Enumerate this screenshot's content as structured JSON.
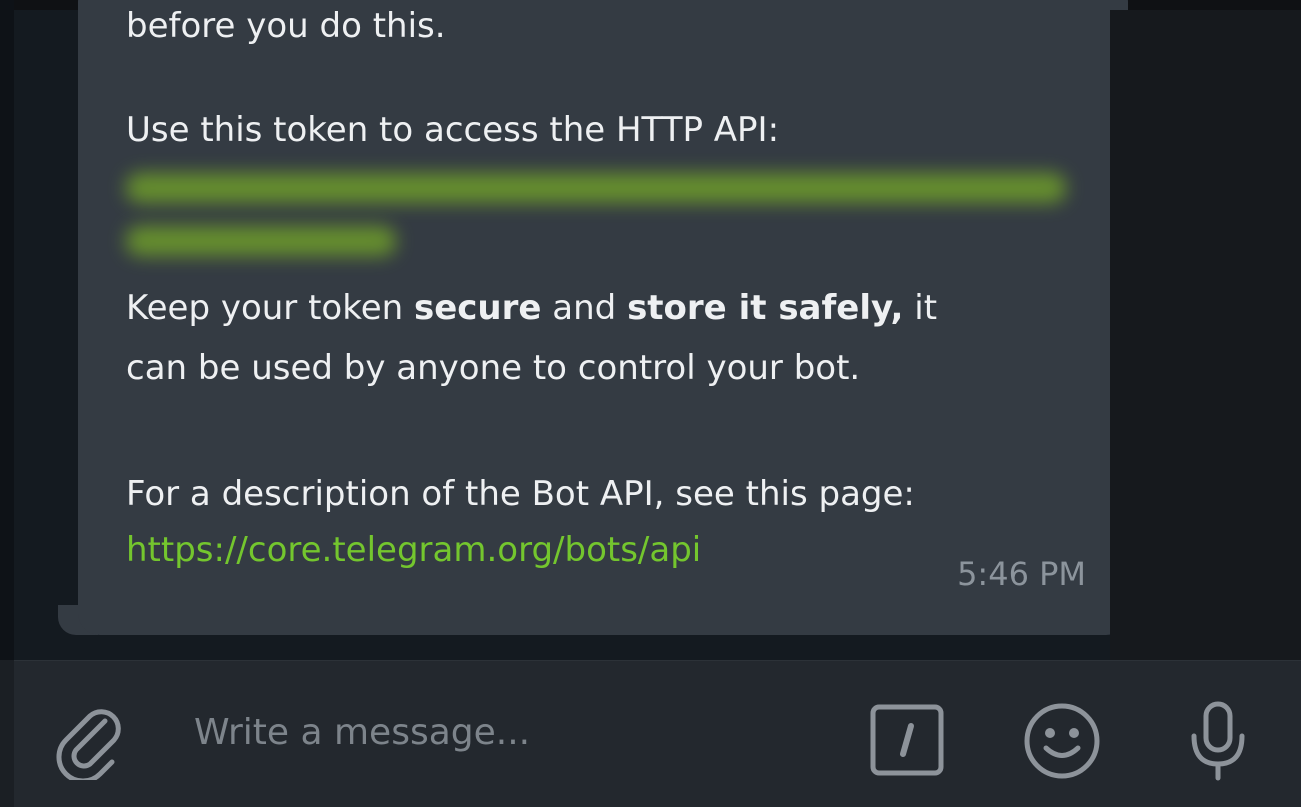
{
  "message": {
    "line_before": "before you do this.",
    "token_intro": "Use this token to access the HTTP API:",
    "keep_prefix": "Keep your token ",
    "keep_bold1": "secure",
    "keep_mid": " and ",
    "keep_bold2": "store it safely,",
    "keep_suffix": " it",
    "keep_line2": "can be used by anyone to control your bot.",
    "desc_line": "For a description of the Bot API, see this page:",
    "link": "https://core.telegram.org/bots/api",
    "time": "5:46 PM"
  },
  "composer": {
    "placeholder": "Write a message..."
  },
  "icons": {
    "attach": "paperclip-icon",
    "commands": "slash-command-icon",
    "emoji": "smiley-icon",
    "voice": "microphone-icon"
  },
  "colors": {
    "bubble": "#343b43",
    "link": "#74c62e",
    "input_bar": "#23282e",
    "icon": "#8d939a"
  }
}
